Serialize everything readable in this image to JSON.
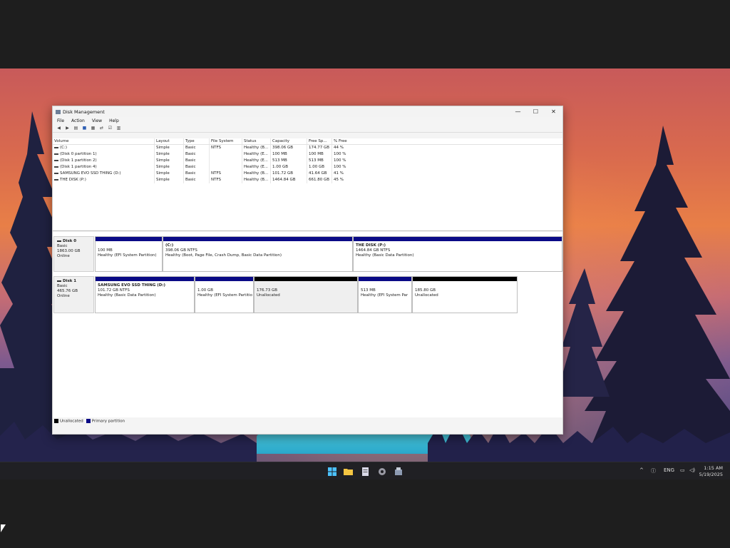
{
  "window": {
    "title": "Disk Management",
    "controls": {
      "minimize": "—",
      "maximize": "☐",
      "close": "✕"
    }
  },
  "menu": [
    "File",
    "Action",
    "View",
    "Help"
  ],
  "volumes": {
    "headers": [
      "Volume",
      "Layout",
      "Type",
      "File System",
      "Status",
      "Capacity",
      "Free Sp...",
      "% Free"
    ],
    "rows": [
      [
        "(C:)",
        "Simple",
        "Basic",
        "NTFS",
        "Healthy (B...",
        "398.06 GB",
        "174.77 GB",
        "44 %"
      ],
      [
        "(Disk 0 partition 1)",
        "Simple",
        "Basic",
        "",
        "Healthy (E...",
        "100 MB",
        "100 MB",
        "100 %"
      ],
      [
        "(Disk 1 partition 2)",
        "Simple",
        "Basic",
        "",
        "Healthy (E...",
        "513 MB",
        "513 MB",
        "100 %"
      ],
      [
        "(Disk 1 partition 4)",
        "Simple",
        "Basic",
        "",
        "Healthy (E...",
        "1.00 GB",
        "1.00 GB",
        "100 %"
      ],
      [
        "SAMSUNG EVO SSD THING (D:)",
        "Simple",
        "Basic",
        "NTFS",
        "Healthy (B...",
        "101.72 GB",
        "41.64 GB",
        "41 %"
      ],
      [
        "THE DISK (P:)",
        "Simple",
        "Basic",
        "NTFS",
        "Healthy (B...",
        "1464.84 GB",
        "661.80 GB",
        "45 %"
      ]
    ]
  },
  "disks": [
    {
      "name": "Disk 0",
      "type": "Basic",
      "size": "1863.00 GB",
      "status": "Online",
      "partitions": [
        {
          "name": "",
          "size": "100 MB",
          "status": "Healthy (EFI System Partition)",
          "kind": "primary"
        },
        {
          "name": "(C:)",
          "size": "398.06 GB NTFS",
          "status": "Healthy (Boot, Page File, Crash Dump, Basic Data Partition)",
          "kind": "primary"
        },
        {
          "name": "THE DISK  (P:)",
          "size": "1464.84 GB NTFS",
          "status": "Healthy (Basic Data Partition)",
          "kind": "primary"
        }
      ]
    },
    {
      "name": "Disk 1",
      "type": "Basic",
      "size": "465.76 GB",
      "status": "Online",
      "partitions": [
        {
          "name": "SAMSUNG EVO SSD THING  (D:)",
          "size": "101.72 GB NTFS",
          "status": "Healthy (Basic Data Partition)",
          "kind": "primary"
        },
        {
          "name": "",
          "size": "1.00 GB",
          "status": "Healthy (EFI System Partitio",
          "kind": "primary"
        },
        {
          "name": "",
          "size": "176.73 GB",
          "status": "Unallocated",
          "kind": "unallocated"
        },
        {
          "name": "",
          "size": "513 MB",
          "status": "Healthy (EFI System Par",
          "kind": "primary"
        },
        {
          "name": "",
          "size": "185.80 GB",
          "status": "Unallocated",
          "kind": "unallocated"
        }
      ]
    }
  ],
  "legend": {
    "unallocated": "Unallocated",
    "primary": "Primary partition"
  },
  "colors": {
    "primary": "#0a0a86",
    "unallocated": "#000000"
  },
  "taskbar": {
    "icons": [
      "windows-start-icon",
      "file-explorer-icon",
      "notepad-icon",
      "settings-icon",
      "disk-management-icon"
    ],
    "tray": {
      "chevron": "^",
      "language": "ENG",
      "time": "1:15 AM",
      "date": "5/19/2025"
    }
  }
}
